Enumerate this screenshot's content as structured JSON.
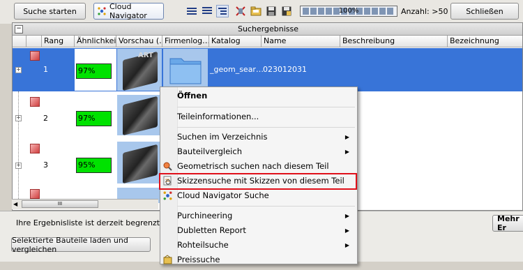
{
  "toolbar": {
    "search_start_label": "Suche starten",
    "cloud_navigator_tab_label": "Cloud Navigator",
    "progress_percent_label": "100%",
    "progress_value": 1.0,
    "count_label": "Anzahl: >50",
    "close_label": "Schließen"
  },
  "results": {
    "panel_title": "Suchergebnisse",
    "columns": [
      "Rang",
      "Ähnlichkeit",
      "Vorschau (…",
      "Firmenlog…",
      "Katalog",
      "Name",
      "Beschreibung",
      "Bezeichnung"
    ],
    "rows": [
      {
        "rank": "1",
        "similarity": "97%",
        "catalog": "_geom_sear…",
        "name": "023012031"
      },
      {
        "rank": "2",
        "similarity": "97%"
      },
      {
        "rank": "3",
        "similarity": "95%"
      }
    ],
    "thumbnail_watermark": "ART"
  },
  "status": {
    "limited_message": "Ihre Ergebnisliste ist derzeit begrenzt.",
    "more_button_label": "Mehr Er",
    "load_compare_button_label": "Selektierte Bauteile laden und vergleichen"
  },
  "context_menu": {
    "items": [
      {
        "label": "Öffnen",
        "bold": true
      },
      {
        "label": "Teileinformationen..."
      },
      {
        "label": "Suchen im Verzeichnis",
        "submenu": true
      },
      {
        "label": "Bauteilvergleich",
        "submenu": true
      },
      {
        "label": "Geometrisch suchen nach diesem Teil",
        "icon": "geometric-search-icon"
      },
      {
        "label": "Skizzensuche mit Skizzen von diesem Teil",
        "icon": "sketch-search-icon",
        "highlighted": true
      },
      {
        "label": "Cloud Navigator Suche",
        "icon": "cloud-navigator-icon"
      },
      {
        "label": "Purchineering",
        "submenu": true
      },
      {
        "label": "Dubletten Report",
        "submenu": true
      },
      {
        "label": "Rohteilsuche",
        "submenu": true
      },
      {
        "label": "Preissuche",
        "icon": "price-search-icon"
      }
    ],
    "submenu_arrow": "▶"
  },
  "colors": {
    "selection": "#3874d8",
    "similarity_fill": "#00e200",
    "highlight_border": "#e0101a"
  }
}
